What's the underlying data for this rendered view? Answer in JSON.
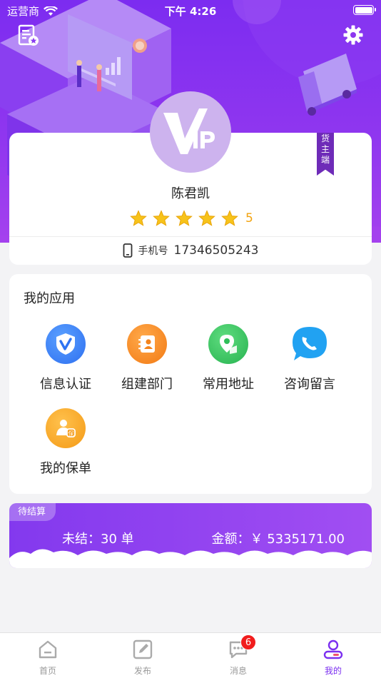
{
  "status_bar": {
    "carrier": "运营商",
    "time": "下午 4:26"
  },
  "profile": {
    "name": "陈君凯",
    "rating": "5",
    "role_ribbon": [
      "货",
      "主",
      "端"
    ],
    "phone_label": "手机号",
    "phone": "17346505243"
  },
  "apps": {
    "title": "我的应用",
    "items": [
      {
        "label": "信息认证",
        "icon": "verify-shield-icon",
        "color": "#2f7cf6"
      },
      {
        "label": "组建部门",
        "icon": "contacts-card-icon",
        "color": "#f58a20"
      },
      {
        "label": "常用地址",
        "icon": "map-location-icon",
        "color": "#2fc25b"
      },
      {
        "label": "咨询留言",
        "icon": "chat-bubble-icon",
        "color": "#24a3f2"
      },
      {
        "label": "我的保单",
        "icon": "insurance-user-icon",
        "color": "#f6a31f"
      }
    ]
  },
  "settlement": {
    "tag": "待结算",
    "pending": "未结：30 单",
    "amount": "金额：￥ 5335171.00"
  },
  "tabbar": {
    "items": [
      {
        "label": "首页",
        "icon": "home-icon"
      },
      {
        "label": "发布",
        "icon": "edit-icon"
      },
      {
        "label": "消息",
        "icon": "message-icon",
        "badge": "6"
      },
      {
        "label": "我的",
        "icon": "user-icon",
        "active": true
      }
    ]
  },
  "colors": {
    "brand": "#7b2ff0",
    "star": "#f7c31a"
  }
}
